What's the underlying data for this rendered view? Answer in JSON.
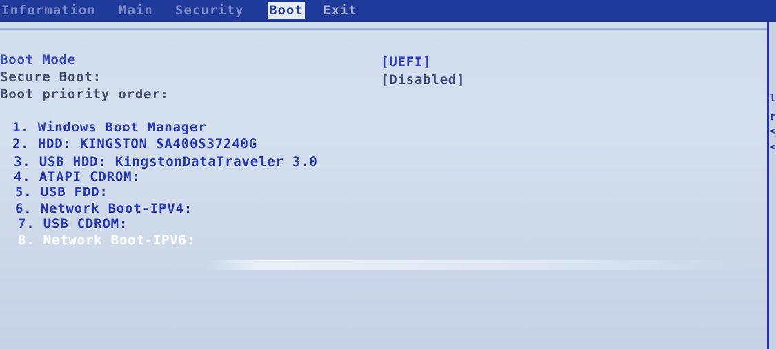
{
  "menu": {
    "tabs": [
      {
        "label": "Information"
      },
      {
        "label": "Main"
      },
      {
        "label": "Security"
      },
      {
        "label": "Boot"
      },
      {
        "label": "Exit"
      }
    ]
  },
  "settings": {
    "boot_mode": {
      "label": "Boot Mode",
      "value": "[UEFI]"
    },
    "secure_boot": {
      "label": "Secure Boot:",
      "value": "[Disabled]"
    },
    "priority": {
      "label": "Boot priority order:"
    }
  },
  "boot_order": [
    "1. Windows Boot Manager",
    "2. HDD: KINGSTON SA400S37240G",
    "3. USB HDD: KingstonDataTraveler 3.0",
    "4. ATAPI CDROM:",
    "5. USB FDD:",
    "6. Network Boot-IPV4:",
    "7. USB CDROM:",
    "8. Network Boot-IPV6:"
  ],
  "selected_item_index": 7,
  "colors": {
    "menubar": "#1f3a9a",
    "background": "#cfdcec",
    "item_text": "#2436b6",
    "selected_text": "#ffffff",
    "panel_border": "#2430c8"
  }
}
